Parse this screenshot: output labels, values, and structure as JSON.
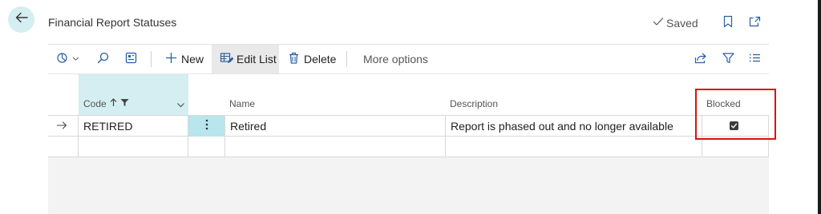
{
  "header": {
    "back_icon": "arrow-left-icon",
    "title": "Financial Report Statuses",
    "saved_label": "Saved",
    "bookmark_icon": "bookmark-icon",
    "open_new_window_icon": "open-in-new-window-icon"
  },
  "toolbar": {
    "analysis_icon": "data-analysis-icon",
    "search_icon": "search-icon",
    "layout_icon": "show-as-cards-icon",
    "new_label": "New",
    "edit_list_label": "Edit List",
    "delete_label": "Delete",
    "more_options_label": "More options",
    "share_icon": "share-icon",
    "filter_icon": "filter-icon",
    "list_view_icon": "list-view-icon"
  },
  "table": {
    "columns": [
      {
        "label": "Code",
        "sort": "ascending",
        "filtered": true
      },
      {
        "label": "Name"
      },
      {
        "label": "Description"
      },
      {
        "label": "Blocked"
      }
    ],
    "rows": [
      {
        "selected": true,
        "code": "RETIRED",
        "name": "Retired",
        "description": "Report is phased out and no longer available",
        "blocked": true
      }
    ]
  },
  "colors": {
    "accent": "#d4eef1",
    "selected_cell": "#b8e6ec",
    "highlight_border": "#e01010"
  }
}
